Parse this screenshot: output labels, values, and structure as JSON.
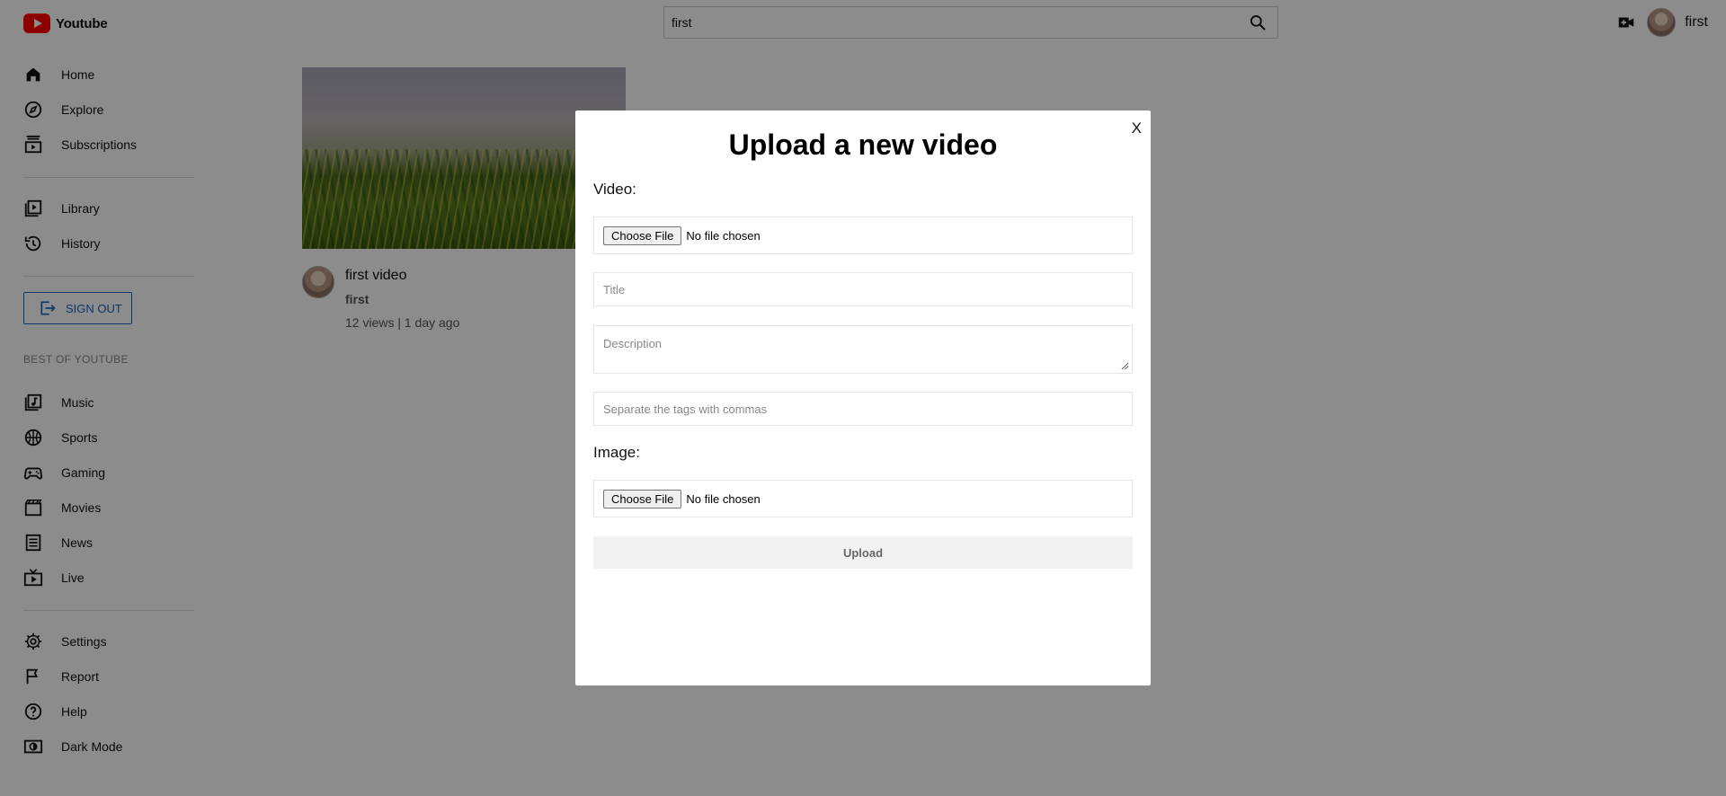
{
  "header": {
    "logo_text": "Youtube",
    "search_value": "first",
    "username": "first"
  },
  "sidebar": {
    "items_top": [
      {
        "label": "Home",
        "icon": "home-icon"
      },
      {
        "label": "Explore",
        "icon": "compass-icon"
      },
      {
        "label": "Subscriptions",
        "icon": "subscriptions-icon"
      }
    ],
    "items_library": [
      {
        "label": "Library",
        "icon": "library-icon"
      },
      {
        "label": "History",
        "icon": "history-icon"
      }
    ],
    "sign_out_label": "SIGN OUT",
    "best_of_label": "BEST OF YOUTUBE",
    "items_best": [
      {
        "label": "Music",
        "icon": "music-icon"
      },
      {
        "label": "Sports",
        "icon": "sports-icon"
      },
      {
        "label": "Gaming",
        "icon": "gaming-icon"
      },
      {
        "label": "Movies",
        "icon": "movies-icon"
      },
      {
        "label": "News",
        "icon": "news-icon"
      },
      {
        "label": "Live",
        "icon": "live-icon"
      }
    ],
    "items_bottom": [
      {
        "label": "Settings",
        "icon": "gear-icon"
      },
      {
        "label": "Report",
        "icon": "flag-icon"
      },
      {
        "label": "Help",
        "icon": "help-icon"
      },
      {
        "label": "Dark Mode",
        "icon": "dark-mode-icon"
      }
    ]
  },
  "video": {
    "title": "first video",
    "channel": "first",
    "stats": "12 views | 1 day ago"
  },
  "modal": {
    "close_label": "X",
    "title": "Upload a new video",
    "video_label": "Video:",
    "video_file_button": "Choose File",
    "video_file_status": "No file chosen",
    "title_placeholder": "Title",
    "description_placeholder": "Description",
    "tags_placeholder": "Separate the tags with commas",
    "image_label": "Image:",
    "image_file_button": "Choose File",
    "image_file_status": "No file chosen",
    "upload_label": "Upload"
  }
}
